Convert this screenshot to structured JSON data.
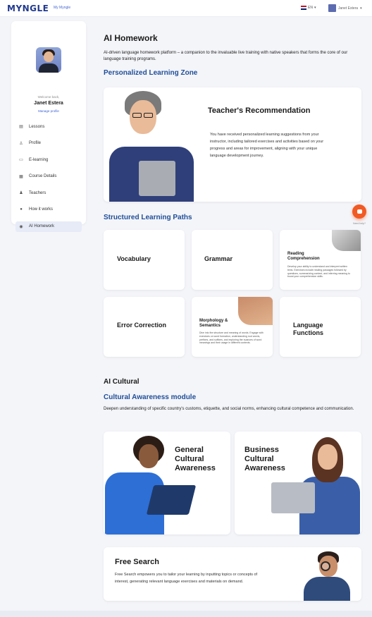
{
  "topbar": {
    "logo": "MYNGLE",
    "nav_link": "My Myngle",
    "language": "EN",
    "user_name": "Janet Estera"
  },
  "sidebar": {
    "welcome": "Welcome back,",
    "user_name": "Janet Estera",
    "profile_link": "Manage profile",
    "items": [
      {
        "label": "Lessons",
        "icon": "lessons-icon",
        "active": false
      },
      {
        "label": "Profile",
        "icon": "profile-icon",
        "active": false
      },
      {
        "label": "E-learning",
        "icon": "elearning-icon",
        "active": false
      },
      {
        "label": "Course Details",
        "icon": "course-icon",
        "active": false
      },
      {
        "label": "Teachers",
        "icon": "teachers-icon",
        "active": false
      },
      {
        "label": "How it works",
        "icon": "info-icon",
        "active": false
      },
      {
        "label": "AI Homework",
        "icon": "ai-icon",
        "active": true
      }
    ]
  },
  "main": {
    "title": "AI Homework",
    "description": "AI-driven language homework platform – a companion to the invaluable live training with native speakers that forms the core of our language training programs.",
    "zone_heading": "Personalized Learning Zone",
    "recommendation": {
      "title": "Teacher's Recommendation",
      "text": "You have received personalized learning suggestions from your instructor, including tailored exercises and activities based on your progress and areas for improvement, aligning with your unique language development journey."
    },
    "paths_heading": "Structured Learning Paths",
    "paths": {
      "vocabulary": "Vocabulary",
      "grammar": "Grammar",
      "reading": "Reading Comprehension",
      "reading_text": "Develop your ability to understand and interpret written texts. Exercises include reading passages followed by questions, summarizing content, and inferring meaning to boost your comprehension skills.",
      "error_correction": "Error Correction",
      "morphology": "Morphology & Semantics",
      "morphology_text": "Dive into the structure and meaning of words. Engage with exercises on word formation, understanding root words, prefixes, and suffixes, and exploring the nuances of word meanings and their usage in different contexts.",
      "functions": "Language Functions"
    },
    "cultural_heading": "AI Cultural",
    "cultural_subheading": "Cultural Awareness module",
    "cultural_description": "Deepen understanding of specific country's customs, etiquette, and social norms, enhancing cultural competence and communication.",
    "general_cultural": "General Cultural Awareness",
    "business_cultural": "Business Cultural Awareness",
    "free_search": {
      "title": "Free Search",
      "text": "Free Search empowers you to tailor your learning by inputting topics or concepts of interest, generating relevant language exercises and materials on demand."
    },
    "help_label": "Need help?"
  },
  "colors": {
    "accent": "#1f4e98",
    "brand_orange": "#f15a24",
    "background": "#f4f5f9",
    "active_nav": "#e6ebf7"
  }
}
